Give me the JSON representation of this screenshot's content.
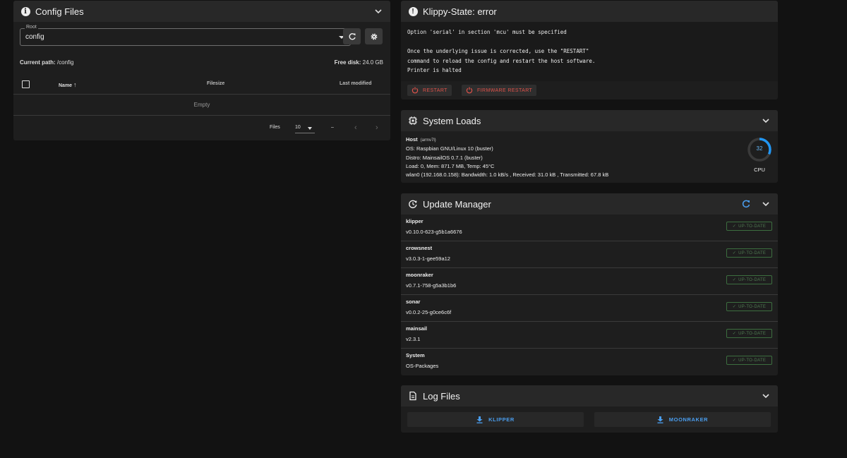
{
  "config_files": {
    "title": "Config Files",
    "root_label": "Root",
    "root_value": "config",
    "current_path_label": "Current path:",
    "current_path_value": "/config",
    "free_disk_label": "Free disk:",
    "free_disk_value": "24.0 GB",
    "columns": {
      "name": "Name",
      "filesize": "Filesize",
      "last_modified": "Last modified"
    },
    "empty_text": "Empty",
    "footer": {
      "files_label": "Files",
      "per_page": "10",
      "range": "–"
    }
  },
  "klippy": {
    "title": "Klippy-State: error",
    "message": "Option 'serial' in section 'mcu' must be specified\n\nOnce the underlying issue is corrected, use the \"RESTART\"\ncommand to reload the config and restart the host software.\nPrinter is halted",
    "restart_label": "RESTART",
    "firmware_restart_label": "FIRMWARE RESTART",
    "accent_color": "#e0524a"
  },
  "system_loads": {
    "title": "System Loads",
    "host_label": "Host",
    "host_arch": "(armv7l)",
    "os_line": "OS: Raspbian GNU/Linux 10 (buster)",
    "distro_line": "Distro: MainsailOS 0.7.1 (buster)",
    "load_line": "Load: 0, Mem: 871.7 MB, Temp: 45°C",
    "network_line": "wlan0 (192.168.0.158): Bandwidth: 1.0 kB/s , Received: 31.0 kB , Transmitted: 67.8 kB",
    "cpu_value": "32",
    "cpu_label": "CPU",
    "cpu_percent": 32
  },
  "update_manager": {
    "title": "Update Manager",
    "badge_color": "#4e7a50",
    "items": [
      {
        "name": "klipper",
        "version": "v0.10.0-623-g5b1a6676",
        "status": "UP-TO-DATE"
      },
      {
        "name": "crowsnest",
        "version": "v3.0.3-1-gee59a12",
        "status": "UP-TO-DATE"
      },
      {
        "name": "moonraker",
        "version": "v0.7.1-758-g5a3b1b6",
        "status": "UP-TO-DATE"
      },
      {
        "name": "sonar",
        "version": "v0.0.2-25-g0ce6c6f",
        "status": "UP-TO-DATE"
      },
      {
        "name": "mainsail",
        "version": "v2.3.1",
        "status": "UP-TO-DATE"
      },
      {
        "name": "System",
        "version": "OS-Packages",
        "status": "UP-TO-DATE"
      }
    ]
  },
  "log_files": {
    "title": "Log Files",
    "klipper_label": "KLIPPER",
    "moonraker_label": "MOONRAKER",
    "accent_color": "#4a9eef"
  }
}
